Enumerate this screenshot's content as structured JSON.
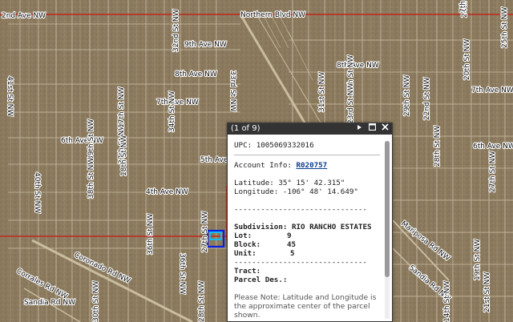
{
  "map": {
    "streets": [
      {
        "id": "pinetree-blvd",
        "label": "Northern Blvd NW"
      },
      {
        "id": "9th-ave",
        "label": "9th Ave NW"
      },
      {
        "id": "8th-ave-left",
        "label": "8th Ave NW"
      },
      {
        "id": "8th-ave-right",
        "label": "8th Ave NW"
      },
      {
        "id": "7th-ave-left",
        "label": "7th Ave NW"
      },
      {
        "id": "7th-ave-right",
        "label": "7th Ave NW"
      },
      {
        "id": "6th-ave-left",
        "label": "6th Ave NW"
      },
      {
        "id": "6th-ave-right",
        "label": "6th Ave NW"
      },
      {
        "id": "5th-ave",
        "label": "5th Ave"
      },
      {
        "id": "4th-ave",
        "label": "4th Ave NW"
      },
      {
        "id": "2nd-ave",
        "label": "2nd Ave NW"
      },
      {
        "id": "41st-st",
        "label": "41st St NW"
      },
      {
        "id": "40th-st",
        "label": "40th St NW"
      },
      {
        "id": "39th-st",
        "label": "39th St NW"
      },
      {
        "id": "38th-st",
        "label": "38th St NW"
      },
      {
        "id": "36th-st-a",
        "label": "36th St NW"
      },
      {
        "id": "36th-st-b",
        "label": "36th St NW"
      },
      {
        "id": "37th-st",
        "label": "37th St NW"
      },
      {
        "id": "34th-st",
        "label": "34th St NW"
      },
      {
        "id": "33rd-st",
        "label": "33rd St NW"
      },
      {
        "id": "32nd-st",
        "label": "32nd St NW"
      },
      {
        "id": "31st-st",
        "label": "31st St NW"
      },
      {
        "id": "30th-st",
        "label": "30th St NW"
      },
      {
        "id": "29th-st",
        "label": "29th St NW"
      },
      {
        "id": "28th-st",
        "label": "28th St NW"
      },
      {
        "id": "27th-st",
        "label": "27th St NW"
      },
      {
        "id": "25th-st",
        "label": "25th St NW"
      },
      {
        "id": "24th-st",
        "label": "24th St NW"
      },
      {
        "id": "23rd-st",
        "label": "23rd St NW"
      },
      {
        "id": "22nd-st",
        "label": "22nd St NW"
      },
      {
        "id": "21st-st",
        "label": "21st St NW"
      },
      {
        "id": "20th-st",
        "label": "20th St NW"
      },
      {
        "id": "19th-st",
        "label": "19th St NW"
      },
      {
        "id": "18th-st",
        "label": "18th St NW"
      },
      {
        "id": "17th-st",
        "label": "17th St NW"
      },
      {
        "id": "coronado-right",
        "label": "Mariposa Rd NW"
      },
      {
        "id": "coronado-left",
        "label": "Coronado Rd NW"
      },
      {
        "id": "sandia",
        "label": "Sandia Rd NW"
      },
      {
        "id": "sandia-right",
        "label": "Sandia Rd NW"
      },
      {
        "id": "corrales",
        "label": "Corrales Rd NW"
      },
      {
        "id": "30th-lower",
        "label": "30th St NW"
      },
      {
        "id": "28th-lower",
        "label": "28th St NW"
      },
      {
        "id": "27th-lower",
        "label": "27th St NW"
      },
      {
        "id": "14th-lower",
        "label": "14th St NW"
      },
      {
        "id": "7th-right",
        "label": "7th St"
      }
    ],
    "colors": {
      "terrain": "#8b7a5e",
      "parcel_line": "#d7ccb4",
      "road": "#b5a88f",
      "boundary": "#c0281e",
      "selection_cyan": "#00c4ff",
      "selection_blue": "#0a1ee6"
    }
  },
  "popup": {
    "count": "(1 of 9)",
    "icons": [
      "pointer-icon",
      "maximize-icon",
      "close-icon"
    ],
    "upc_label": "UPC:",
    "upc_value": "1005069332016",
    "account_label": "Account Info:",
    "account_value": "R020757",
    "latitude_label": "Latitude:",
    "latitude_value": "35° 15' 42.315\"",
    "longitude_label": "Longitude:",
    "longitude_value": "-106° 48' 14.649\"",
    "dashes": "------------------------------",
    "subdivision_label": "Subdivision:",
    "subdivision_value": "RIO RANCHO ESTATES",
    "lot_label": "Lot:",
    "lot_value": "9",
    "block_label": "Block:",
    "block_value": "45",
    "unit_label": "Unit:",
    "unit_value": "5",
    "tract_label": "Tract:",
    "parcel_desc_label": "Parcel Des.:",
    "note": "Please Note: Latitude and Longitude is the approximate center of the parcel shown."
  }
}
